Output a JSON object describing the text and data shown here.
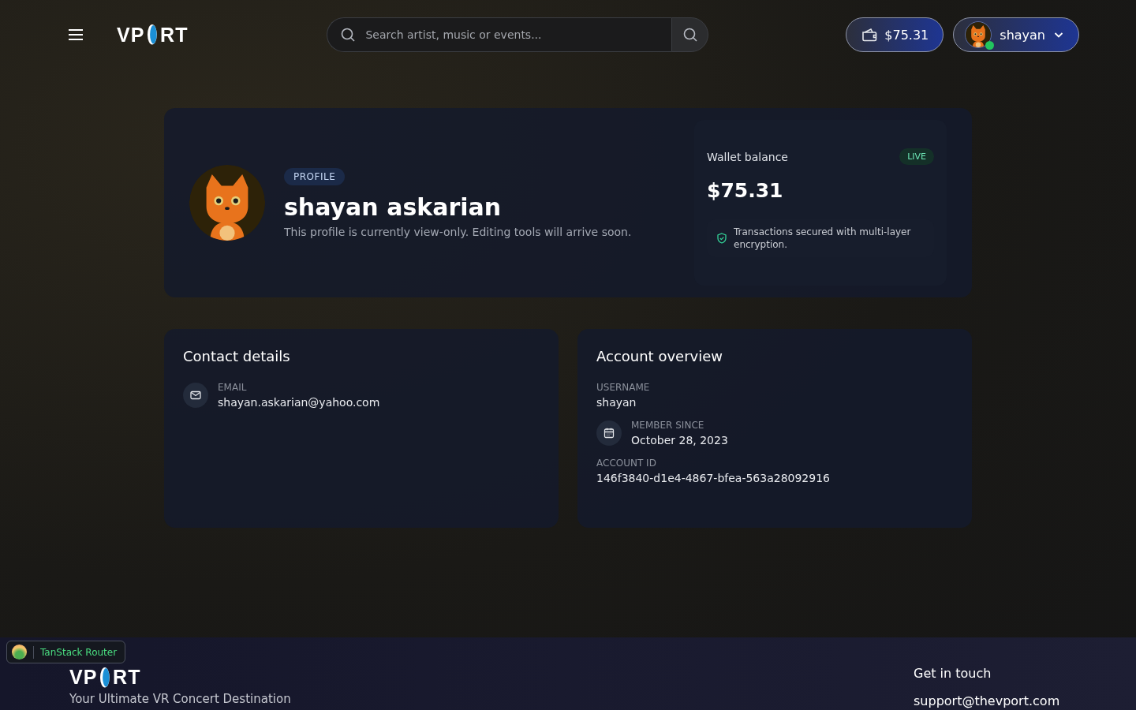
{
  "header": {
    "logo": {
      "left": "VP",
      "right": "RT"
    },
    "search": {
      "placeholder": "Search artist, music or events..."
    },
    "wallet_button": "$75.31",
    "user_menu": {
      "name": "shayan",
      "online": true
    }
  },
  "profile": {
    "badge": "PROFILE",
    "name": "shayan askarian",
    "note": "This profile is currently view-only. Editing tools will arrive soon.",
    "wallet": {
      "label": "Wallet balance",
      "status": "LIVE",
      "amount": "$75.31",
      "security_note": "Transactions secured with multi-layer encryption."
    }
  },
  "contact_details": {
    "title": "Contact details",
    "fields": [
      {
        "kind": "mail",
        "label": "EMAIL",
        "value": "shayan.askarian@yahoo.com"
      }
    ]
  },
  "account_overview": {
    "title": "Account overview",
    "fields": [
      {
        "kind": "plain",
        "label": "USERNAME",
        "value": "shayan"
      },
      {
        "kind": "calendar",
        "label": "MEMBER SINCE",
        "value": "October 28, 2023"
      },
      {
        "kind": "plain",
        "label": "ACCOUNT ID",
        "value": "146f3840-d1e4-4867-bfea-563a28092916"
      }
    ]
  },
  "footer": {
    "logo": {
      "left": "VP",
      "right": "RT"
    },
    "tagline": "Your Ultimate VR Concert Destination",
    "contact_title": "Get in touch",
    "email": "support@thevport.com"
  },
  "devtools_badge": "TanStack Router"
}
